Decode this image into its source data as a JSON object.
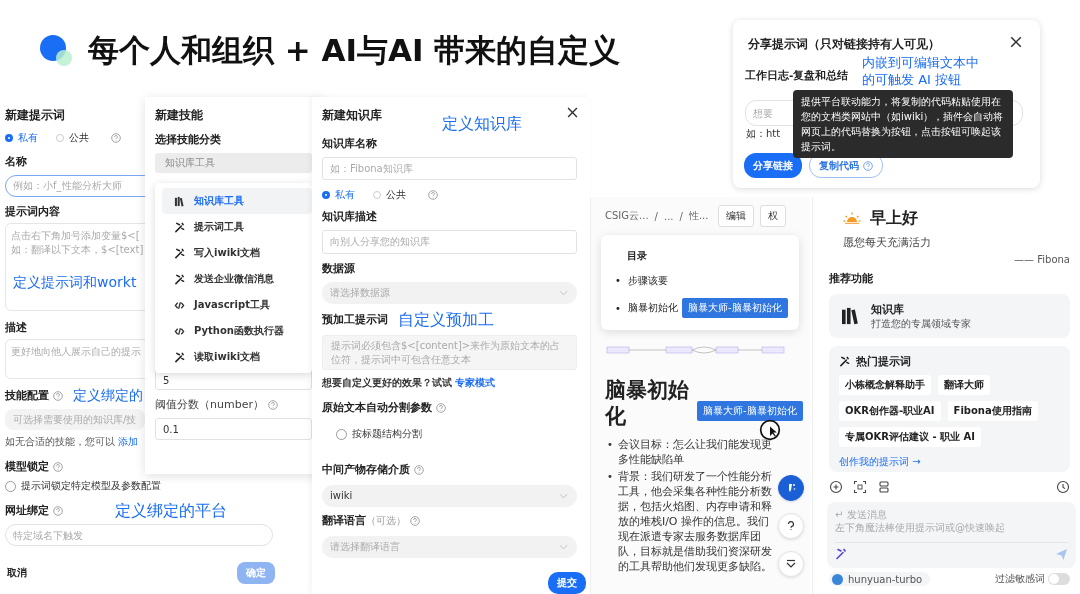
{
  "slide_title": "每个人和组织 + AI与AI 带来的自定义",
  "prompt_form": {
    "title": "新建提示词",
    "visibility": [
      {
        "label": "私有",
        "selected": true
      },
      {
        "label": "公共",
        "selected": false
      }
    ],
    "name_field": {
      "label": "名称",
      "placeholder": "例如：小f_性能分析大师"
    },
    "content_field": {
      "label": "提示词内容",
      "placeholder_lines": [
        "点击右下角加号添加变量$<[",
        "如：翻译以下文本，$<[text]"
      ],
      "annotation": "定义提示词和workt"
    },
    "description_field": {
      "label": "描述",
      "placeholder": "更好地向他人展示自己的提示"
    },
    "skill_field": {
      "label": "技能配置",
      "annotation": "定义绑定的",
      "placeholder": "可选择需要使用的知识库/技",
      "hint": "如无合适的技能，您可以",
      "hint_link": "添加"
    },
    "model_lock": {
      "label": "模型锁定",
      "option": {
        "label": "提示词锁定特定模型及参数配置",
        "checked": false
      }
    },
    "url_field": {
      "label": "网址绑定",
      "annotation": "定义绑定的平台",
      "placeholder": "特定域名下触发"
    },
    "cancel": "取消",
    "confirm": {
      "label": "确定",
      "disabled": true
    }
  },
  "skill_form": {
    "title": "新建技能",
    "category_label": "选择技能分类",
    "category_value": "知识库工具",
    "menu": [
      {
        "kind": "books",
        "label": "知识库工具",
        "selected": true
      },
      {
        "kind": "wand",
        "label": "提示词工具",
        "selected": false
      },
      {
        "kind": "wand",
        "label": "写入iwiki文档",
        "selected": false
      },
      {
        "kind": "wand",
        "label": "发送企业微信消息",
        "selected": false
      },
      {
        "kind": "code",
        "label": "Javascript工具",
        "selected": false
      },
      {
        "kind": "code",
        "label": "Python函数执行器",
        "selected": false
      },
      {
        "kind": "wand",
        "label": "读取iwiki文档",
        "selected": false
      }
    ],
    "count_value": "5",
    "threshold": {
      "label": "阈值分数（number）",
      "value": "0.1"
    }
  },
  "knowledge_form": {
    "title": "新建知识库",
    "annotation": "定义知识库",
    "name_field": {
      "label": "知识库名称",
      "placeholder": "如：Fibona知识库"
    },
    "visibility": [
      {
        "label": "私有",
        "selected": true
      },
      {
        "label": "公共",
        "selected": false
      }
    ],
    "description_field": {
      "label": "知识库描述",
      "placeholder": "向别人分享您的知识库"
    },
    "source_field": {
      "label": "数据源",
      "placeholder": "请选择数据源"
    },
    "preprocess_field": {
      "label": "预加工提示词",
      "annotation": "自定义预加工",
      "placeholder": "提示词必须包含$<[content]>来作为原始文本的占位符，提示词中可包含任意文本"
    },
    "expert_hint": "想要自定义更好的效果？试试",
    "expert_link": "专家模式",
    "split": {
      "label": "原始文本自动分割参数",
      "option": {
        "label": "按标题结构分割",
        "checked": false
      }
    },
    "storage_field": {
      "label": "中间产物存储介质",
      "value": "iwiki"
    },
    "language_field": {
      "label": "翻译语言",
      "optional": "（可选）",
      "placeholder": "请选择翻译语言"
    },
    "submit": "提交"
  },
  "doc_page": {
    "breadcrumb": [
      "CSIG云...",
      "/",
      "...",
      "/",
      "性..."
    ],
    "actions": [
      "编辑",
      "权"
    ],
    "toc": {
      "title": "目录",
      "items": [
        {
          "marker": "•",
          "label": "步骤该要"
        },
        {
          "marker": "•",
          "label": "脑暴初始化",
          "button": "脑暴大师-脑暴初始化"
        }
      ]
    },
    "heading": "脑暴初始化",
    "heading_button": "脑暴大师-脑暴初始化",
    "bullets": [
      {
        "marker": "•",
        "text": "会议目标：怎么让我们能发现更多性能缺陷单"
      },
      {
        "marker": "•",
        "text": "背景：我们研发了一个性能分析工具，他会采集各种性能分析数据，包括火焰图、内存申请和释放的堆栈I/O 操作的信息。我们现在派遣专家去服务数据库团队，目标就是借助我们资深研发的工具帮助他们发现更多缺陷。"
      }
    ]
  },
  "chat_panel": {
    "greeting": "早上好",
    "subtitle": "愿您每天充满活力",
    "signature": "—— Fibona",
    "section_title": "推荐功能",
    "feature": {
      "title": "知识库",
      "subtitle": "打造您的专属领域专家"
    },
    "hot_title": "热门提示词",
    "hot_prompts": [
      "小栋概念解释助手",
      "翻译大师",
      "OKR创作器-职业AI",
      "Fibona使用指南",
      "专属OKR评估建议 - 职业 AI"
    ],
    "create_link": "创作我的提示词 →",
    "message_field": {
      "placeholder_lines": [
        "↵ 发送消息",
        "左下角魔法棒使用提示词或@快速唤起"
      ]
    },
    "model": "hunyuan-turbo",
    "filter": {
      "label": "过滤敏感词",
      "on": false
    }
  },
  "share_dialog": {
    "title": "分享提示词（只对链接持有人可见）",
    "annotation_lines": [
      "内嵌到可编辑文本中",
      "的可触发 AI 按钮"
    ],
    "prompt_name": "工作日志-复盘和总结",
    "input_placeholder": "想要",
    "example": "如：htt",
    "tooltip": "提供平台联动能力，将复制的代码粘贴使用在您的文档类网站中（如iwiki），插件会自动将网页上的代码替换为按钮，点击按钮可唤起该提示词。",
    "share_button": "分享链接",
    "copy_button": "复制代码"
  }
}
